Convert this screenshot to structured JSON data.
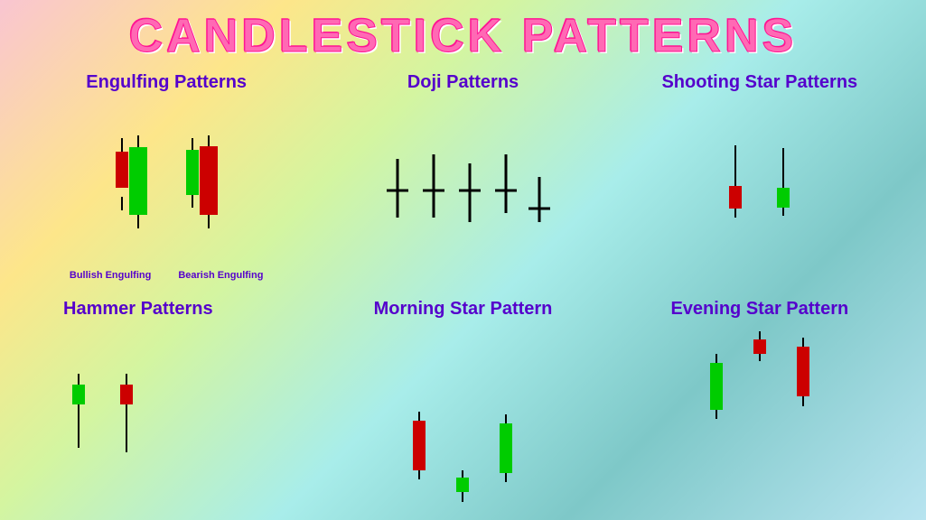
{
  "title": "CANDLESTICK PATTERNS",
  "sections": {
    "engulfing": {
      "title": "Engulfing Patterns",
      "labels": [
        "Bullish Engulfing",
        "Bearish Engulfing"
      ]
    },
    "doji": {
      "title": "Doji  Patterns"
    },
    "shooting_star": {
      "title": "Shooting Star Patterns"
    },
    "hammer": {
      "title": "Hammer Patterns"
    },
    "morning_star": {
      "title": "Morning Star Pattern"
    },
    "evening_star": {
      "title": "Evening Star Pattern"
    }
  },
  "colors": {
    "bullish": "#00cc00",
    "bearish": "#cc0000",
    "title_purple": "#5500cc",
    "title_pink": "#ff69b4"
  }
}
